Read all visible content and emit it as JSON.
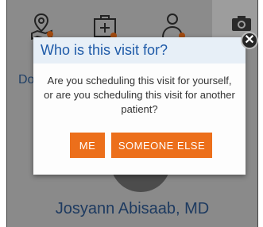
{
  "background": {
    "left_label": "Do",
    "doctor_name": "Josyann Abisaab, MD",
    "icons": [
      "map-pin-icon",
      "medical-kit-icon",
      "person-icon",
      "camera-icon"
    ]
  },
  "dialog": {
    "title": "Who is this visit for?",
    "body": "Are you scheduling this visit for yourself, or are you scheduling this visit for another patient?",
    "buttons": {
      "me": "ME",
      "someone_else": "SOMEONE ELSE"
    },
    "close_glyph": "✕"
  },
  "colors": {
    "accent": "#ec6f1b",
    "title_text": "#1e5aa8",
    "title_bg": "#e7eff7",
    "overlay": "#8a8a8a"
  }
}
